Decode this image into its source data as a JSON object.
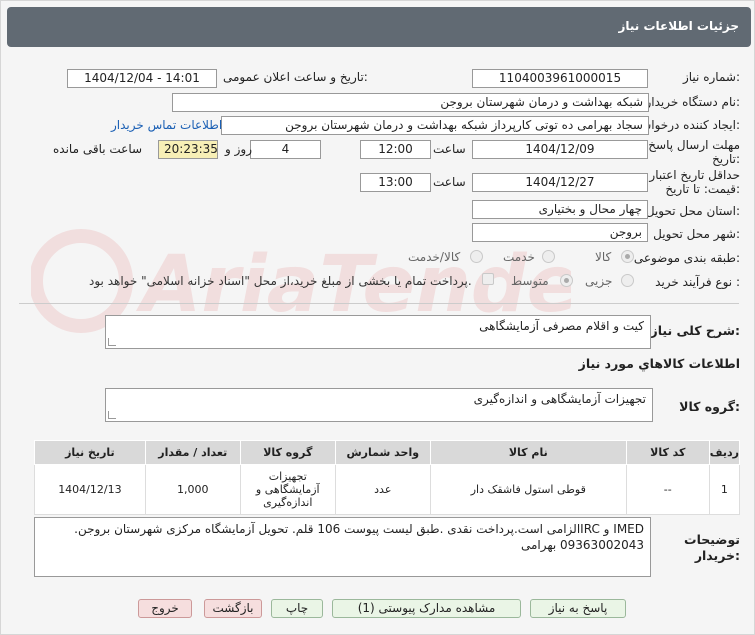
{
  "header": {
    "title": "جزئیات اطلاعات نیاز"
  },
  "form": {
    "need_number_label": "شماره نیاز:",
    "need_number": "1104003961000015",
    "announce_label": "تاریخ و ساعت اعلان عمومی:",
    "announce_value": "1404/12/04 - 14:01",
    "buyer_org_label": "نام دستگاه خریدار:",
    "buyer_org": "شبکه بهداشت و درمان شهرستان بروجن",
    "creator_label": "ایجاد کننده درخواست:",
    "creator": "سجاد بهرامی ده توتی کارپرداز شبکه بهداشت و درمان شهرستان بروجن",
    "contact_link": "اطلاعات تماس خریدار",
    "deadline_label_1": "مهلت ارسال پاسخ: تا",
    "deadline_label_2": "تاریخ:",
    "deadline_date": "1404/12/09",
    "time_label": "ساعت",
    "deadline_time": "12:00",
    "days_value": "4",
    "days_label": "روز و",
    "remaining_time": "20:23:35",
    "remaining_label": "ساعت باقی مانده",
    "validity_label_1": "حداقل تاریخ اعتبار",
    "validity_label_2": "قیمت: تا تاریخ:",
    "validity_date": "1404/12/27",
    "validity_time": "13:00",
    "province_label": "استان محل تحویل:",
    "province": "چهار محال و بختیاری",
    "city_label": "شهر محل تحویل:",
    "city": "بروجن",
    "category_label": "طبقه بندی موضوعی:",
    "category_options": [
      "کالا",
      "خدمت",
      "کالا/خدمت"
    ],
    "process_label": "نوع فرآیند خرید :",
    "process_options": [
      "جزیی",
      "متوسط"
    ],
    "payment_note": "پرداخت تمام یا بخشی از مبلغ خرید،از محل \"اسناد خزانه اسلامی\" خواهد بود."
  },
  "summary": {
    "label": "شرح کلی نیاز:",
    "value": "کیت و اقلام مصرفی آزمایشگاهی"
  },
  "goods_info": {
    "title": "اطلاعات کالاهاي مورد نياز",
    "group_label": "گروه کالا:",
    "group_value": "تجهیزات آزمایشگاهی و اندازه‌گیری"
  },
  "table": {
    "headers": [
      "ردیف",
      "کد کالا",
      "نام کالا",
      "واحد شمارش",
      "گروه کالا",
      "تعداد / مقدار",
      "تاریخ نیاز"
    ],
    "rows": [
      [
        "1",
        "--",
        "قوطی استول فاشقک دار",
        "عدد",
        "تجهیزات آزمایشگاهی و اندازه‌گیری",
        "1,000",
        "1404/12/13"
      ]
    ]
  },
  "notes": {
    "label_1": "توضیحات",
    "label_2": "خریدار:",
    "line1": "IMED و IRCالزامی است.پرداخت نقدی .طبق لیست پیوست 106 قلم. تحویل آزمایشگاه مرکزی شهرستان بروجن.",
    "line2": "09363002043 بهرامی"
  },
  "buttons": {
    "reply": "پاسخ به نیاز",
    "attachments": "مشاهده مدارک پیوستی (1)",
    "print": "چاپ",
    "back": "بازگشت",
    "exit": "خروج"
  },
  "watermark": {
    "text": "AriaTender.net"
  }
}
